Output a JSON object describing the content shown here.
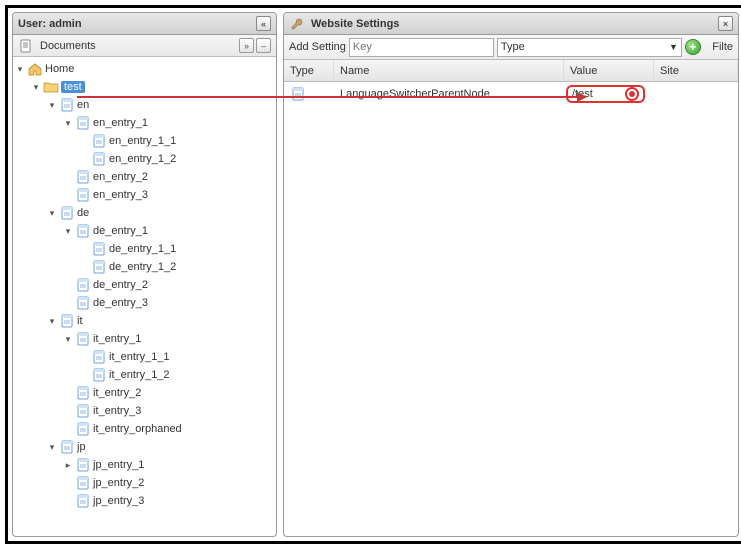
{
  "left": {
    "title": "User: admin",
    "subheader": "Documents",
    "tree": [
      {
        "depth": 0,
        "toggle": "down",
        "icon": "home",
        "label": "Home"
      },
      {
        "depth": 1,
        "toggle": "down",
        "icon": "folder",
        "label": "test",
        "selected": true
      },
      {
        "depth": 2,
        "toggle": "down",
        "icon": "page",
        "label": "en"
      },
      {
        "depth": 3,
        "toggle": "down",
        "icon": "page",
        "label": "en_entry_1"
      },
      {
        "depth": 4,
        "toggle": "",
        "icon": "page",
        "label": "en_entry_1_1"
      },
      {
        "depth": 4,
        "toggle": "",
        "icon": "page",
        "label": "en_entry_1_2"
      },
      {
        "depth": 3,
        "toggle": "",
        "icon": "page",
        "label": "en_entry_2"
      },
      {
        "depth": 3,
        "toggle": "",
        "icon": "page",
        "label": "en_entry_3"
      },
      {
        "depth": 2,
        "toggle": "down",
        "icon": "page",
        "label": "de"
      },
      {
        "depth": 3,
        "toggle": "down",
        "icon": "page",
        "label": "de_entry_1"
      },
      {
        "depth": 4,
        "toggle": "",
        "icon": "page",
        "label": "de_entry_1_1"
      },
      {
        "depth": 4,
        "toggle": "",
        "icon": "page",
        "label": "de_entry_1_2"
      },
      {
        "depth": 3,
        "toggle": "",
        "icon": "page",
        "label": "de_entry_2"
      },
      {
        "depth": 3,
        "toggle": "",
        "icon": "page",
        "label": "de_entry_3"
      },
      {
        "depth": 2,
        "toggle": "down",
        "icon": "page",
        "label": "it"
      },
      {
        "depth": 3,
        "toggle": "down",
        "icon": "page",
        "label": "it_entry_1"
      },
      {
        "depth": 4,
        "toggle": "",
        "icon": "page",
        "label": "it_entry_1_1"
      },
      {
        "depth": 4,
        "toggle": "",
        "icon": "page",
        "label": "it_entry_1_2"
      },
      {
        "depth": 3,
        "toggle": "",
        "icon": "page",
        "label": "it_entry_2"
      },
      {
        "depth": 3,
        "toggle": "",
        "icon": "page",
        "label": "it_entry_3"
      },
      {
        "depth": 3,
        "toggle": "",
        "icon": "page",
        "label": "it_entry_orphaned"
      },
      {
        "depth": 2,
        "toggle": "down",
        "icon": "page",
        "label": "jp"
      },
      {
        "depth": 3,
        "toggle": "right",
        "icon": "page",
        "label": "jp_entry_1"
      },
      {
        "depth": 3,
        "toggle": "",
        "icon": "page",
        "label": "jp_entry_2"
      },
      {
        "depth": 3,
        "toggle": "",
        "icon": "page",
        "label": "jp_entry_3"
      }
    ]
  },
  "right": {
    "title": "Website Settings",
    "toolbar": {
      "add_label": "Add Setting",
      "key_placeholder": "Key",
      "type_placeholder": "Type",
      "filter_label": "Filte"
    },
    "columns": {
      "type": "Type",
      "name": "Name",
      "value": "Value",
      "site": "Site"
    },
    "rows": [
      {
        "icon": "page",
        "name": "LanguageSwitcherParentNode",
        "value": "/test",
        "site": ""
      }
    ]
  }
}
